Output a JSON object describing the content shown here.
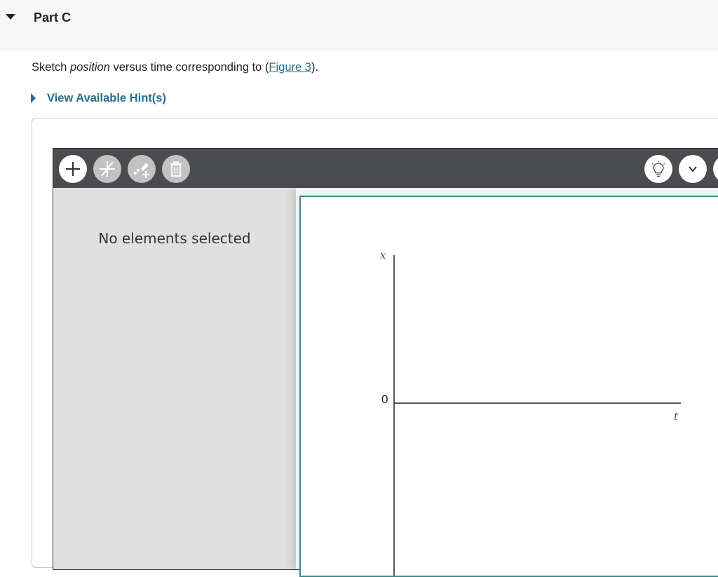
{
  "part": {
    "title": "Part C"
  },
  "question": {
    "prefix": "Sketch ",
    "emphasis": "position",
    "middle": " versus time corresponding to (",
    "link": "Figure 3",
    "suffix": ")."
  },
  "hint": {
    "label": "View Available Hint(s)"
  },
  "toolbar": {
    "left_buttons": [
      "add-icon",
      "line-icon",
      "add-point-icon",
      "trash-icon"
    ],
    "right_buttons": [
      "hint-bulb-icon",
      "chevron-down-icon"
    ]
  },
  "side_panel": {
    "status": "No elements selected"
  },
  "graph": {
    "y_axis_label": "x",
    "x_axis_label": "t",
    "origin_label": "0"
  },
  "colors": {
    "link": "#2a6c8e",
    "toolbar": "#4a4c50",
    "graph_border": "#3a8a8a"
  }
}
